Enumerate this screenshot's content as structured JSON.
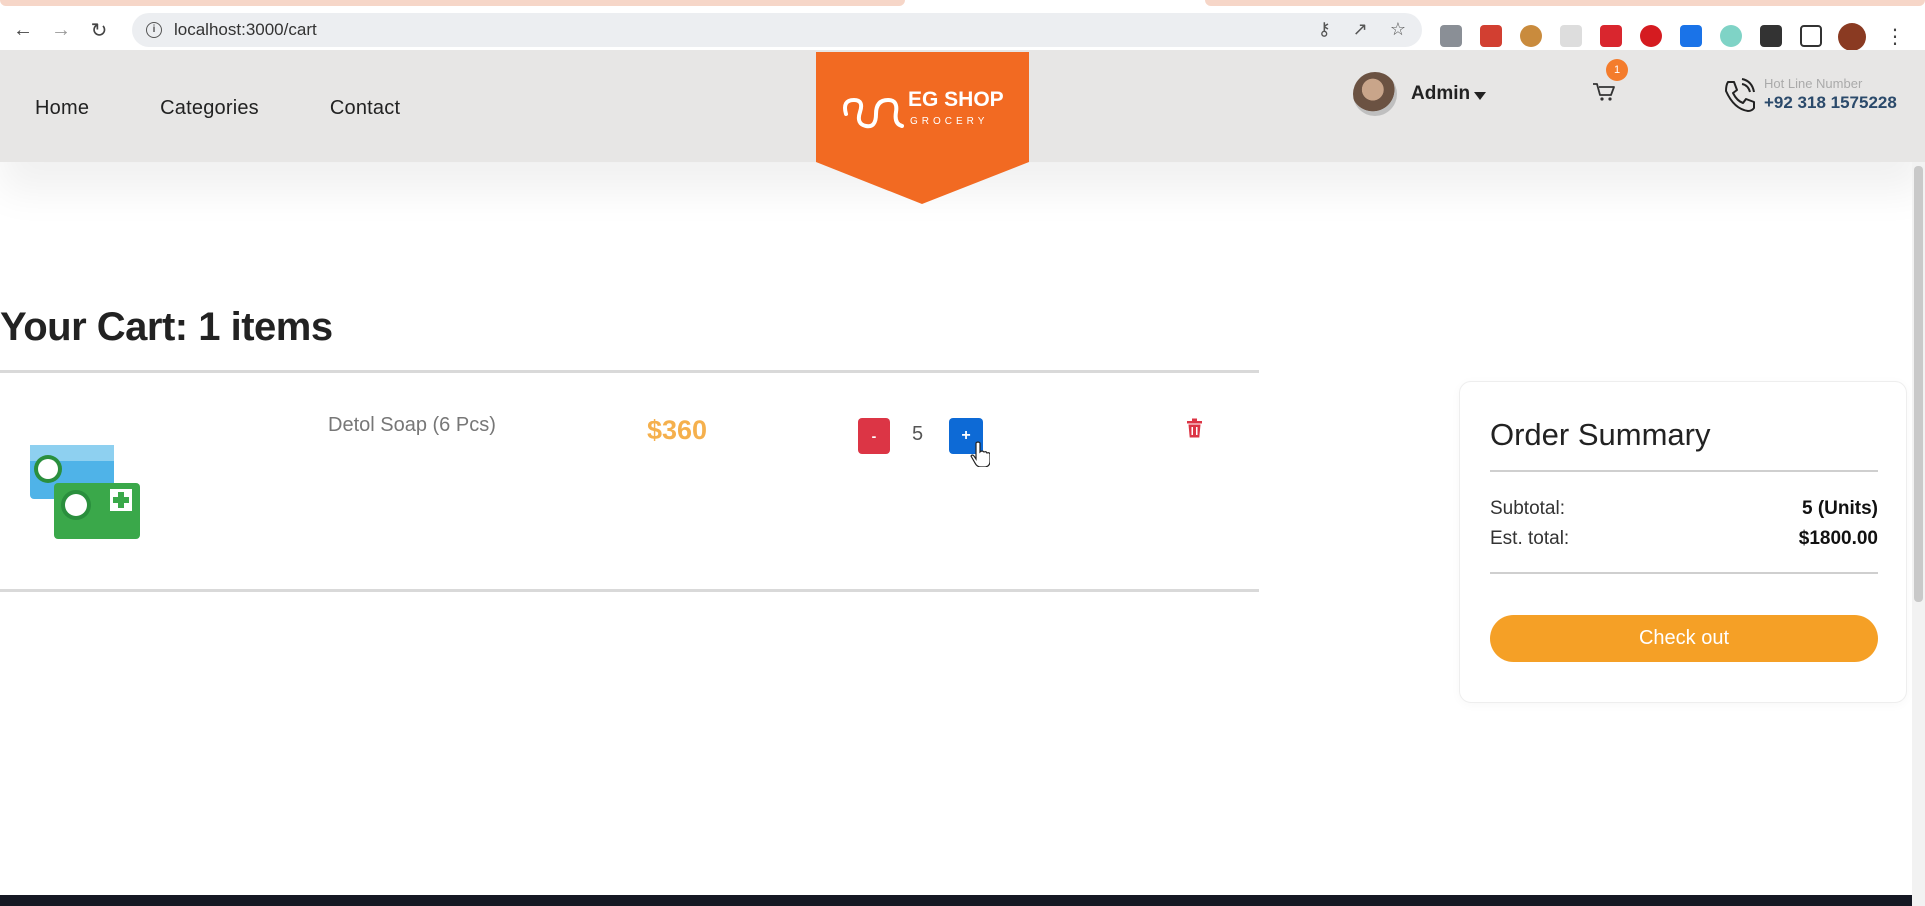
{
  "browser": {
    "url": "localhost:3000/cart",
    "extension_colors": [
      "#8a8f96",
      "#d23f31",
      "#c98b3d",
      "#aaaaaa",
      "#d9262e",
      "#d51b20",
      "#1a73e8",
      "#7fd3c6",
      "#333333",
      "#333333"
    ]
  },
  "nav": {
    "home": "Home",
    "categories": "Categories",
    "contact": "Contact"
  },
  "logo": {
    "line1": "EG SHOP",
    "line2": "GROCERY",
    "color": "#f26a22"
  },
  "user": {
    "name": "Admin"
  },
  "cart_badge": "1",
  "hotline": {
    "label": "Hot Line Number",
    "number": "+92 318 1575228"
  },
  "cart": {
    "title_prefix": "Your Cart: ",
    "title_count": "1 items",
    "items": [
      {
        "name": "Detol Soap (6 Pcs)",
        "price": "$360",
        "qty": "5",
        "minus": "-",
        "plus": "+"
      }
    ]
  },
  "summary": {
    "title": "Order Summary",
    "subtotal_label": "Subtotal:",
    "subtotal_value": "5 (Units)",
    "total_label": "Est. total:",
    "total_value": "$1800.00",
    "checkout": "Check out"
  },
  "colors": {
    "accent_orange": "#f5a026",
    "price_color": "#f5b04d",
    "danger": "#dc3545",
    "primary": "#0d6ad6"
  }
}
